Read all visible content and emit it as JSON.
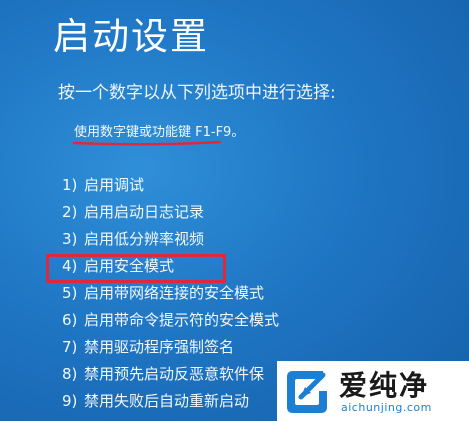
{
  "screen": {
    "title": "启动设置",
    "prompt": "按一个数字以从下列选项中进行选择:",
    "hint": "使用数字键或功能键 F1-F9。",
    "highlight_color": "#e0283c",
    "background_color": "#1f76c4"
  },
  "options": [
    {
      "num": "1)",
      "label": "启用调试"
    },
    {
      "num": "2)",
      "label": "启用启动日志记录"
    },
    {
      "num": "3)",
      "label": "启用低分辨率视频"
    },
    {
      "num": "4)",
      "label": "启用安全模式"
    },
    {
      "num": "5)",
      "label": "启用带网络连接的安全模式"
    },
    {
      "num": "6)",
      "label": "启用带命令提示符的安全模式"
    },
    {
      "num": "7)",
      "label": "禁用驱动程序强制签名"
    },
    {
      "num": "8)",
      "label": "禁用预先启动反恶意软件保"
    },
    {
      "num": "9)",
      "label": "禁用失败后自动重新启动"
    }
  ],
  "watermark": {
    "brand": "爱纯净",
    "url": "aichunjing.com",
    "logo_icon": "aichunjing-logo-icon",
    "url_color": "#1b7fd4"
  }
}
